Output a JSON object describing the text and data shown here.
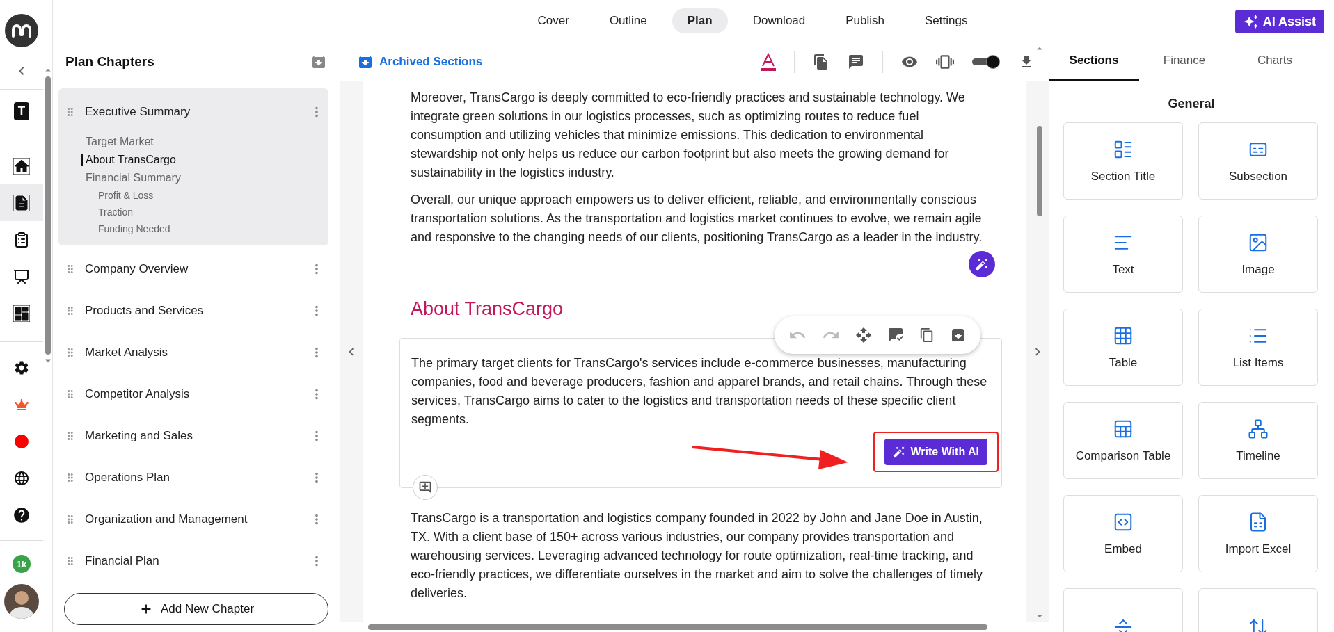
{
  "rail": {
    "workspace_badge": "T",
    "credits_badge": "1k",
    "nav": [
      {
        "selected": false
      },
      {
        "selected": true
      },
      {
        "selected": false
      },
      {
        "selected": false
      },
      {
        "selected": false
      }
    ]
  },
  "top_tabs": [
    {
      "label": "Cover",
      "selected": false
    },
    {
      "label": "Outline",
      "selected": false
    },
    {
      "label": "Plan",
      "selected": true
    },
    {
      "label": "Download",
      "selected": false
    },
    {
      "label": "Publish",
      "selected": false
    },
    {
      "label": "Settings",
      "selected": false
    }
  ],
  "ai_assist": "AI Assist",
  "sidebar": {
    "title": "Plan Chapters",
    "add_button": "Add New Chapter",
    "chapters": [
      {
        "label": "Executive Summary",
        "expanded": true,
        "children": [
          {
            "label": "Target Market",
            "selected": false
          },
          {
            "label": "About TransCargo",
            "selected": true
          },
          {
            "label": "Financial Summary",
            "selected": false,
            "children": [
              {
                "label": "Profit & Loss",
                "selected": false
              },
              {
                "label": "Traction",
                "selected": false
              },
              {
                "label": "Funding Needed",
                "selected": false
              }
            ]
          }
        ]
      },
      {
        "label": "Company Overview",
        "expanded": false
      },
      {
        "label": "Products and Services",
        "expanded": false
      },
      {
        "label": "Market Analysis",
        "expanded": false
      },
      {
        "label": "Competitor Analysis",
        "expanded": false
      },
      {
        "label": "Marketing and Sales",
        "expanded": false
      },
      {
        "label": "Operations Plan",
        "expanded": false
      },
      {
        "label": "Organization and Management",
        "expanded": false
      },
      {
        "label": "Financial Plan",
        "expanded": false
      }
    ]
  },
  "editor_toolbar": {
    "archived_link": "Archived Sections",
    "preview_switch": {
      "on": true
    }
  },
  "document": [
    {
      "kind": "paragraph",
      "text": "Moreover, TransCargo is deeply committed to eco-friendly practices and sustainable technology. We integrate green solutions in our logistics processes, such as optimizing routes to reduce fuel consumption and utilizing vehicles that minimize emissions. This dedication to environmental stewardship not only helps us reduce our carbon footprint but also meets the growing demand for sustainability in the logistics industry."
    },
    {
      "kind": "paragraph",
      "text": "Overall, our unique approach empowers us to deliver efficient, reliable, and environmentally conscious transportation solutions. As the transportation and logistics market continues to evolve, we remain agile and responsive to the changing needs of our clients, positioning TransCargo as a leader in the industry.",
      "ai_wand": true
    },
    {
      "kind": "heading",
      "text": "About TransCargo"
    },
    {
      "kind": "card",
      "text": "The primary target clients for TransCargo's services include e-commerce businesses, manufacturing companies, food and beverage producers, fashion and apparel brands, and retail chains. Through these services, TransCargo aims to cater to the logistics and transportation needs of these specific client segments.",
      "action": "Write With AI"
    },
    {
      "kind": "paragraph",
      "text": "TransCargo is a transportation and logistics company founded in 2022 by John and Jane Doe in Austin, TX. With a client base of 150+ across various industries, our company provides transportation and warehousing services. Leveraging advanced technology for route optimization, real-time tracking, and eco-friendly practices, we differentiate ourselves in the market and aim to solve the challenges of timely deliveries."
    }
  ],
  "right_panel": {
    "tabs": [
      {
        "label": "Sections",
        "selected": true
      },
      {
        "label": "Finance",
        "selected": false
      },
      {
        "label": "Charts",
        "selected": false
      }
    ],
    "group_title": "General",
    "blocks": [
      {
        "kind": "tile",
        "label": "Section Title"
      },
      {
        "kind": "tile",
        "label": "Subsection"
      },
      {
        "kind": "tile",
        "label": "Text"
      },
      {
        "kind": "tile",
        "label": "Image"
      },
      {
        "kind": "tile",
        "label": "Table"
      },
      {
        "kind": "tile",
        "label": "List Items"
      },
      {
        "kind": "tile",
        "label": "Comparison Table"
      },
      {
        "kind": "tile",
        "label": "Timeline"
      },
      {
        "kind": "tile",
        "label": "Embed"
      },
      {
        "kind": "tile",
        "label": "Import Excel"
      },
      {
        "kind": "tile"
      },
      {
        "kind": "tile"
      }
    ]
  }
}
